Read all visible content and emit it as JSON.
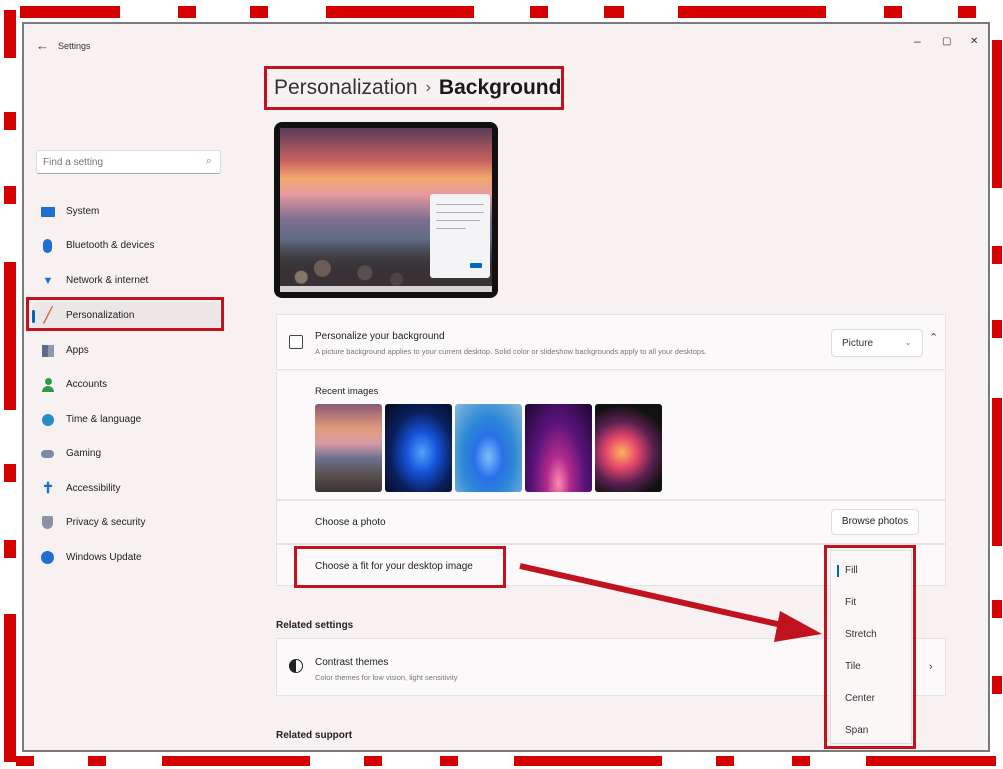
{
  "window": {
    "title": "Settings",
    "back_glyph": "←",
    "controls": {
      "minimize": "–",
      "maximize": "▢",
      "close": "✕"
    }
  },
  "search": {
    "placeholder": "Find a setting",
    "icon": "search-icon"
  },
  "sidebar": {
    "items": [
      {
        "label": "System",
        "icon": "monitor-icon",
        "active": false
      },
      {
        "label": "Bluetooth & devices",
        "icon": "bluetooth-icon",
        "active": false
      },
      {
        "label": "Network & internet",
        "icon": "wifi-icon",
        "active": false
      },
      {
        "label": "Personalization",
        "icon": "brush-icon",
        "active": true
      },
      {
        "label": "Apps",
        "icon": "apps-icon",
        "active": false
      },
      {
        "label": "Accounts",
        "icon": "person-icon",
        "active": false
      },
      {
        "label": "Time & language",
        "icon": "globe-clock-icon",
        "active": false
      },
      {
        "label": "Gaming",
        "icon": "gamepad-icon",
        "active": false
      },
      {
        "label": "Accessibility",
        "icon": "accessibility-icon",
        "active": false
      },
      {
        "label": "Privacy & security",
        "icon": "shield-icon",
        "active": false
      },
      {
        "label": "Windows Update",
        "icon": "update-icon",
        "active": false
      }
    ]
  },
  "breadcrumb": {
    "parent": "Personalization",
    "separator": "›",
    "current": "Background"
  },
  "personalize": {
    "title": "Personalize your background",
    "subtitle": "A picture background applies to your current desktop. Solid color or slideshow backgrounds apply to all your desktops.",
    "select_value": "Picture",
    "icon": "image-icon"
  },
  "recent": {
    "label": "Recent images",
    "count": 5
  },
  "choose_photo": {
    "label": "Choose a photo",
    "button": "Browse photos"
  },
  "choose_fit": {
    "label": "Choose a fit for your desktop image"
  },
  "fit_menu": {
    "options": [
      "Fill",
      "Fit",
      "Stretch",
      "Tile",
      "Center",
      "Span"
    ],
    "selected": "Fill"
  },
  "related_settings": {
    "heading": "Related settings",
    "items": [
      {
        "title": "Contrast themes",
        "subtitle": "Color themes for low vision, light sensitivity",
        "icon": "contrast-icon"
      }
    ]
  },
  "related_support": {
    "heading": "Related support"
  },
  "colors": {
    "highlight": "#c1121f",
    "accent": "#0067c0",
    "frame": "#d50000"
  }
}
